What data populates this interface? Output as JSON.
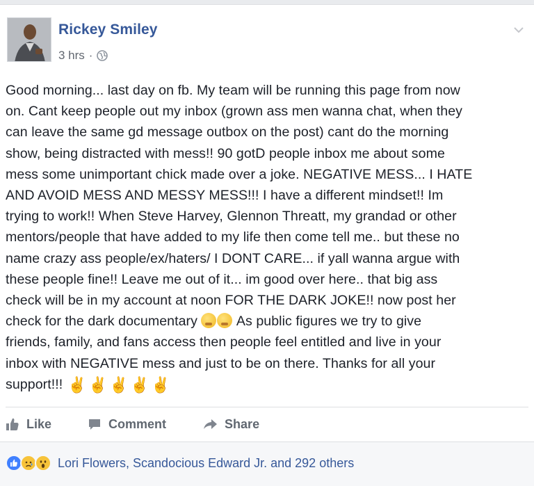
{
  "post": {
    "author": "Rickey Smiley",
    "time": "3 hrs",
    "separator": "·",
    "privacy_icon": "globe-icon",
    "menu_icon": "chevron-down-icon",
    "text_lines": [
      "Good morning... last day on fb. My team will be running this page from now",
      "on. Cant keep people out my inbox (grown ass men wanna chat, when they",
      "can leave the same gd message outbox on the post) cant do the morning",
      "show, being distracted with mess!! 90 gotD people inbox me about some",
      "mess some unimportant chick made over a joke. NEGATIVE MESS... I HATE",
      "AND AVOID MESS AND MESSY MESS!!! I have a different mindset!! Im",
      "trying to work!! When Steve Harvey, Glennon Threatt, my grandad or other",
      "mentors/people that have added to my life then come tell me.. but these no",
      "name crazy ass people/ex/haters/ I DONT CARE... if yall wanna argue with",
      "these people fine!! Leave me out of it... im good over here.. that big ass",
      "check will be in my account at noon FOR THE DARK JOKE!! now post her"
    ],
    "line12_before": "check for the dark documentary",
    "line12_after": "As public figures we try to give",
    "text_lines_tail": [
      "friends, family, and fans access then people feel entitled and live in your",
      "inbox with NEGATIVE mess and just to be on there. Thanks for all your"
    ],
    "last_line": "support!!!",
    "victory_emoji": "✌",
    "victory_count": 5
  },
  "actions": {
    "like": "Like",
    "comment": "Comment",
    "share": "Share"
  },
  "reactions": {
    "icons": [
      "like-reaction-icon",
      "sad-reaction-icon",
      "wow-reaction-icon"
    ],
    "names": "Lori Flowers, Scandocious Edward Jr. and 292 others"
  },
  "colors": {
    "link": "#365899",
    "text": "#1d2129",
    "muted": "#616770",
    "like_blue": "#4080ff"
  }
}
